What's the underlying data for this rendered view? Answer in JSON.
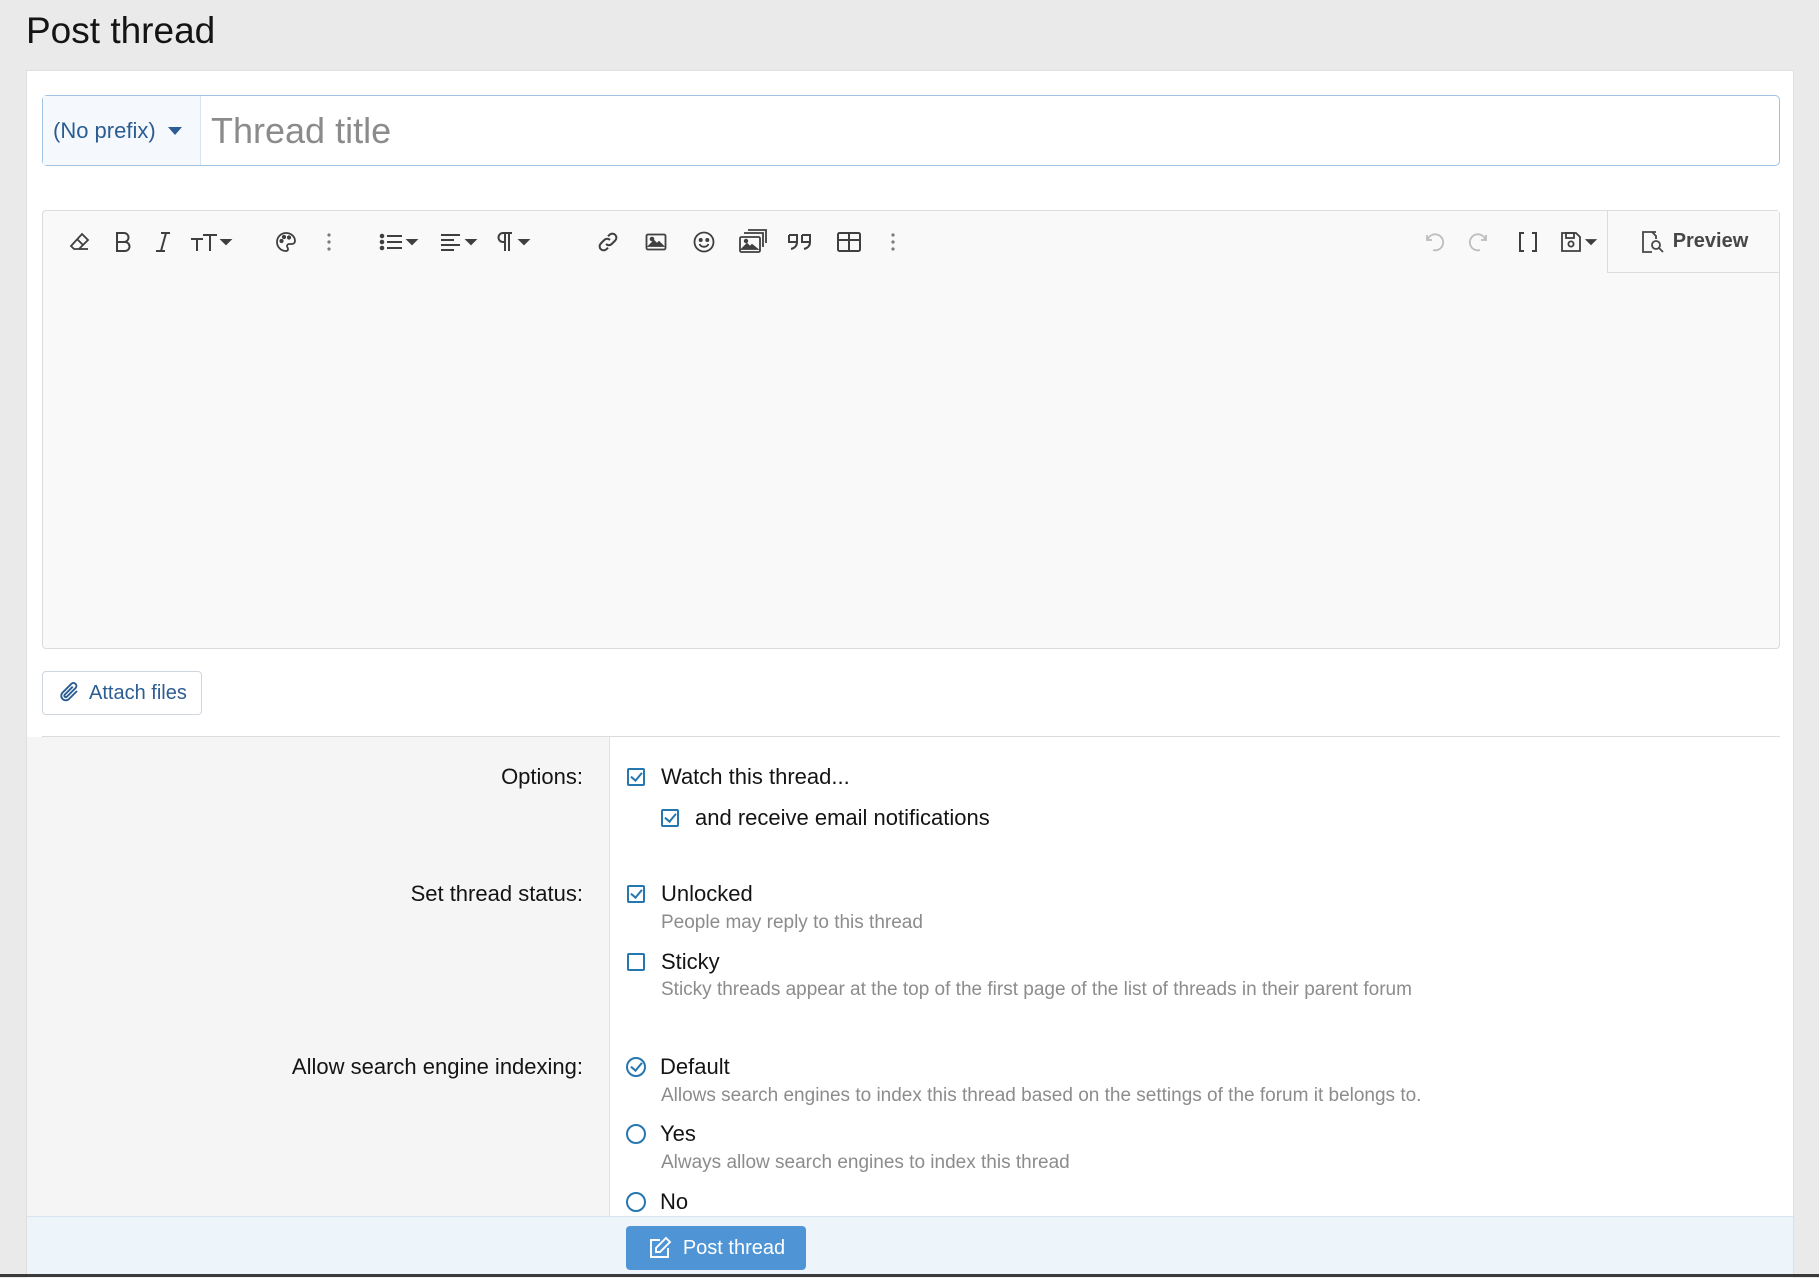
{
  "page": {
    "title": "Post thread"
  },
  "title_row": {
    "prefix_label": "(No prefix)",
    "title_placeholder": "Thread title"
  },
  "toolbar": {
    "left_icons": [
      "eraser-icon",
      "bold-icon",
      "italic-icon",
      "font-size-icon",
      "palette-icon",
      "more-vertical-icon",
      "list-icon",
      "align-icon",
      "paragraph-icon",
      "link-icon",
      "image-icon",
      "smiley-icon",
      "media-icon",
      "quote-icon",
      "table-icon",
      "more-vertical-icon"
    ],
    "right_icons": [
      "undo-icon",
      "redo-icon",
      "bbcode-toggle-icon",
      "drafts-icon"
    ],
    "preview_label": "Preview"
  },
  "attach": {
    "label": "Attach files"
  },
  "options": {
    "label": "Options:",
    "watch_label": "Watch this thread...",
    "watch_checked": true,
    "email_label": "and receive email notifications",
    "email_checked": true
  },
  "status": {
    "label": "Set thread status:",
    "unlocked_label": "Unlocked",
    "unlocked_checked": true,
    "unlocked_hint": "People may reply to this thread",
    "sticky_label": "Sticky",
    "sticky_checked": false,
    "sticky_hint": "Sticky threads appear at the top of the first page of the list of threads in their parent forum"
  },
  "indexing": {
    "label": "Allow search engine indexing:",
    "selected": "Default",
    "default_label": "Default",
    "default_hint": "Allows search engines to index this thread based on the settings of the forum it belongs to.",
    "yes_label": "Yes",
    "yes_hint": "Always allow search engines to index this thread",
    "no_label": "No"
  },
  "footer": {
    "post_label": "Post thread"
  },
  "colors": {
    "accent": "#2577b1",
    "link": "#2c5d92",
    "button": "#4f95d6",
    "footer_bg": "#edf5fb"
  }
}
